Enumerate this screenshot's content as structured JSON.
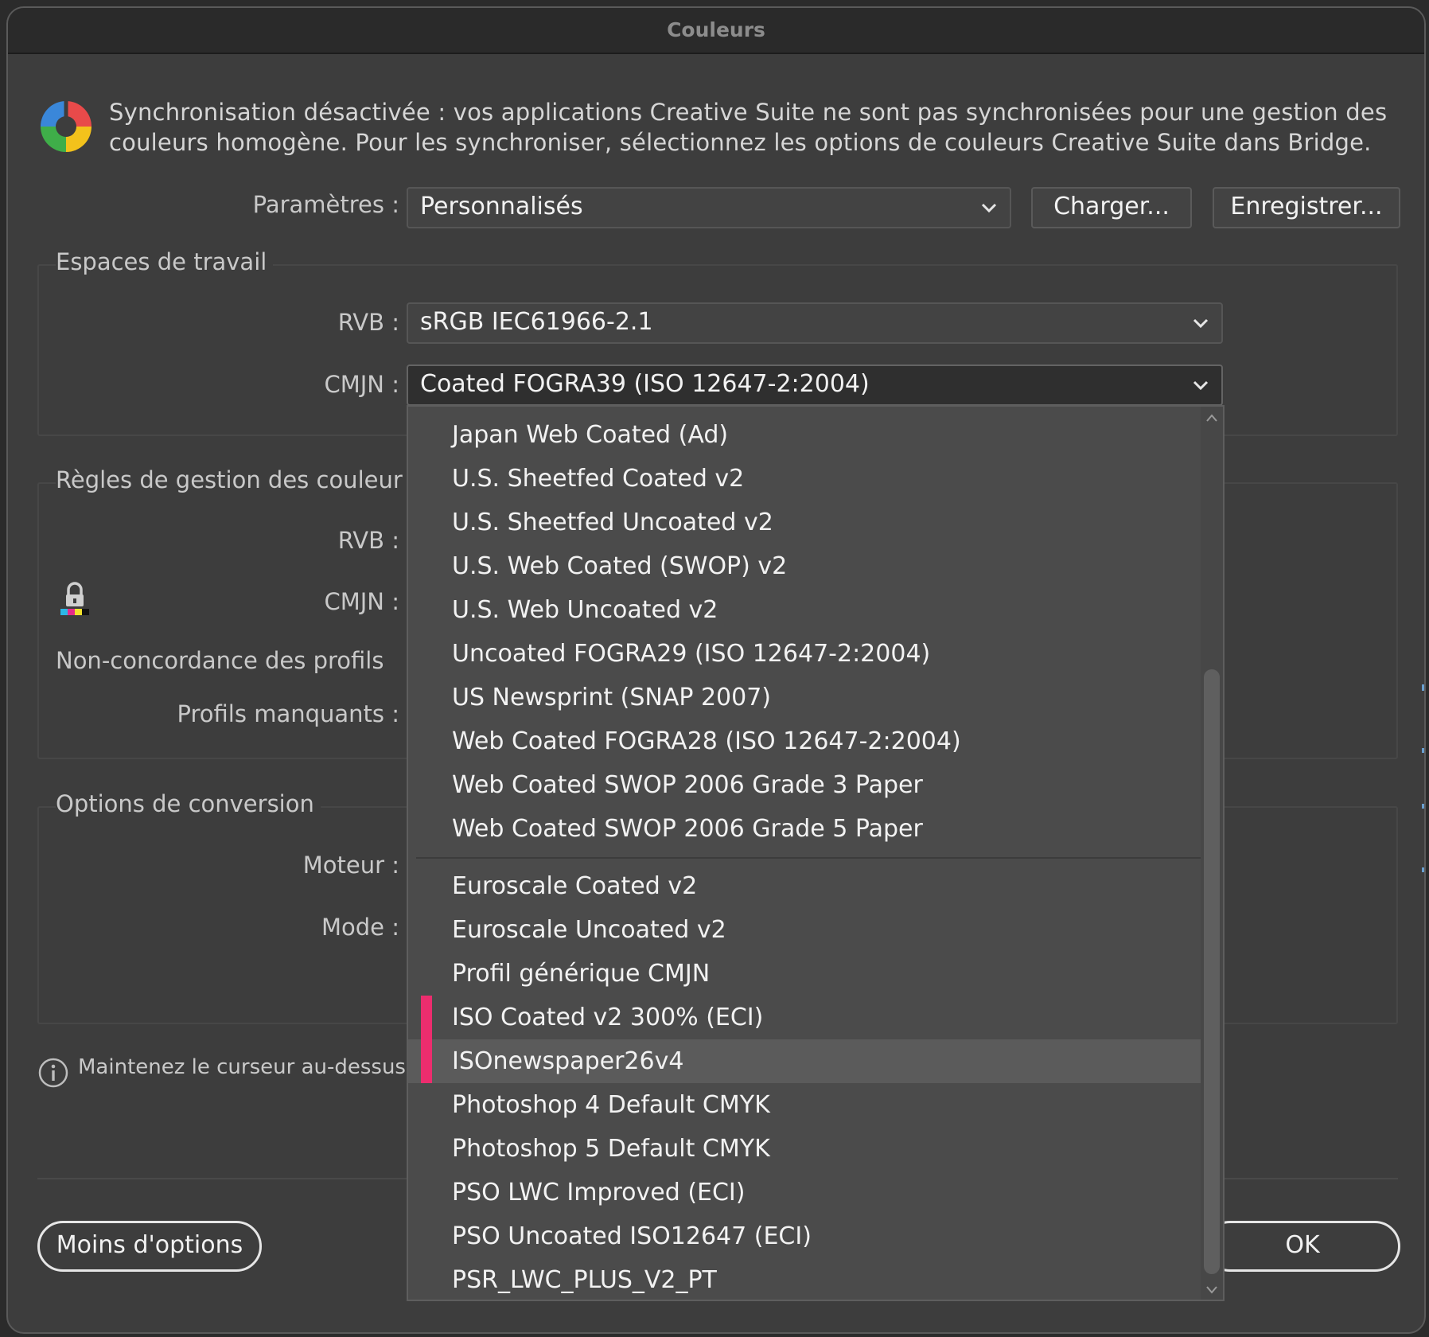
{
  "window": {
    "title": "Couleurs"
  },
  "sync": {
    "icon": "color-sync-icon",
    "message": "Synchronisation désactivée : vos applications Creative Suite ne sont pas synchronisées pour une gestion des couleurs homogène. Pour les synchroniser, sélectionnez les options de couleurs Creative Suite dans Bridge."
  },
  "settings": {
    "label": "Paramètres :",
    "value": "Personnalisés",
    "load_button": "Charger...",
    "save_button": "Enregistrer..."
  },
  "working_spaces": {
    "title": "Espaces de travail",
    "rgb_label": "RVB :",
    "rgb_value": "sRGB IEC61966-2.1",
    "cmyk_label": "CMJN :",
    "cmyk_value": "Coated FOGRA39 (ISO 12647-2:2004)"
  },
  "color_rules": {
    "title": "Règles de gestion des couleur",
    "rgb_label": "RVB :",
    "cmyk_label": "CMJN :",
    "lock_icon": "lock-icon",
    "mismatch_label": "Non-concordance des profils",
    "missing_label": "Profils manquants :"
  },
  "conversion": {
    "title": "Options de conversion",
    "engine_label": "Moteur :",
    "mode_label": "Mode :"
  },
  "info": {
    "icon": "info-icon",
    "text": "Maintenez le curseur au-dessus c"
  },
  "footer": {
    "less_options_button": "Moins d'options",
    "ok_button": "OK"
  },
  "dropdown": {
    "group1": [
      "Japan Web Coated (Ad)",
      "U.S. Sheetfed Coated v2",
      "U.S. Sheetfed Uncoated v2",
      "U.S. Web Coated (SWOP) v2",
      "U.S. Web Uncoated v2",
      "Uncoated FOGRA29 (ISO 12647-2:2004)",
      "US Newsprint (SNAP 2007)",
      "Web Coated FOGRA28 (ISO 12647-2:2004)",
      "Web Coated SWOP 2006 Grade 3 Paper",
      "Web Coated SWOP 2006 Grade 5 Paper"
    ],
    "group2": [
      "Euroscale Coated v2",
      "Euroscale Uncoated v2",
      "Profil générique CMJN",
      "ISO Coated v2 300% (ECI)",
      "ISOnewspaper26v4",
      "Photoshop 4 Default CMYK",
      "Photoshop 5 Default CMYK",
      "PSO LWC Improved (ECI)",
      "PSO Uncoated ISO12647 (ECI)",
      "PSR_LWC_PLUS_V2_PT"
    ],
    "hovered_item": "ISOnewspaper26v4",
    "marker_color": "#ec2d6e"
  },
  "colors": {
    "background": "#3d3d3d",
    "titlebar": "#2a2a2a",
    "menu": "#4b4b4b",
    "hover": "#5b5b5b",
    "accent_marker": "#ec2d6e"
  }
}
